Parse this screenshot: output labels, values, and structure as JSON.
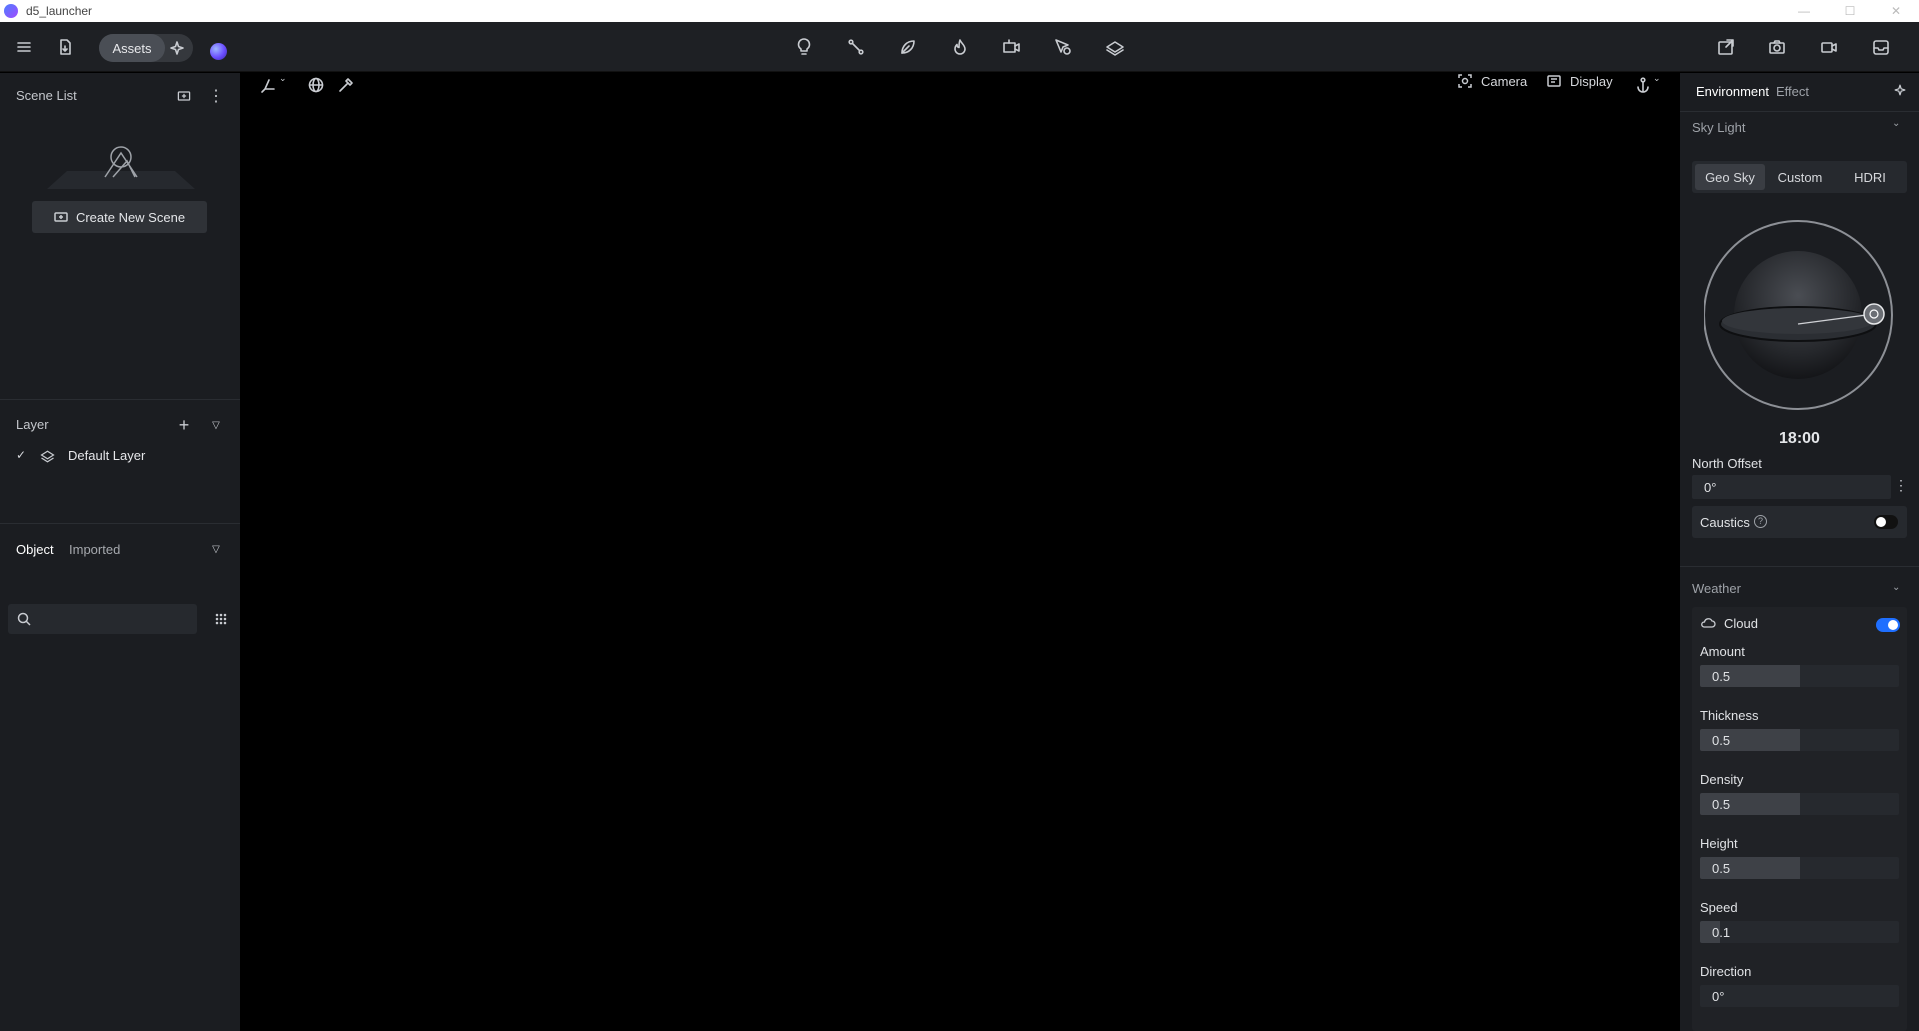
{
  "window": {
    "title": "d5_launcher"
  },
  "toolbar": {
    "assets_label": "Assets",
    "center_icons": [
      "light-bulb-icon",
      "path-icon",
      "leaf-icon",
      "fire-icon",
      "camera-rig-icon",
      "cursor-tag-icon",
      "layers-icon"
    ],
    "right_icons": [
      "export-image-icon",
      "screenshot-icon",
      "video-icon",
      "inbox-icon"
    ]
  },
  "scene_list": {
    "title": "Scene List",
    "create_label": "Create New Scene"
  },
  "layer": {
    "title": "Layer",
    "items": [
      {
        "label": "Default Layer",
        "visible": true
      }
    ]
  },
  "objects": {
    "tabs": [
      "Object",
      "Imported"
    ],
    "active_tab": "Object",
    "search_placeholder": ""
  },
  "viewport": {
    "camera_label": "Camera",
    "display_label": "Display"
  },
  "environment": {
    "tabs": [
      "Environment",
      "Effect"
    ],
    "active_tab": "Environment",
    "sky_light": {
      "title": "Sky Light",
      "modes": [
        "Geo Sky",
        "Custom",
        "HDRI"
      ],
      "active_mode": "Geo Sky",
      "time": "18:00",
      "north_offset_label": "North Offset",
      "north_offset_value": "0°",
      "caustics_label": "Caustics",
      "caustics_on": false
    },
    "weather": {
      "title": "Weather",
      "cloud_label": "Cloud",
      "cloud_on": true,
      "params": [
        {
          "label": "Amount",
          "value": "0.5",
          "fraction": 0.5
        },
        {
          "label": "Thickness",
          "value": "0.5",
          "fraction": 0.5
        },
        {
          "label": "Density",
          "value": "0.5",
          "fraction": 0.5
        },
        {
          "label": "Height",
          "value": "0.5",
          "fraction": 0.5
        },
        {
          "label": "Speed",
          "value": "0.1",
          "fraction": 0.1
        },
        {
          "label": "Direction",
          "value": "0°",
          "fraction": 0.0
        }
      ]
    }
  },
  "colors": {
    "accent": "#1f6fff",
    "panel_bg": "#1b1d21",
    "toolbar_bg": "#1e2024"
  }
}
